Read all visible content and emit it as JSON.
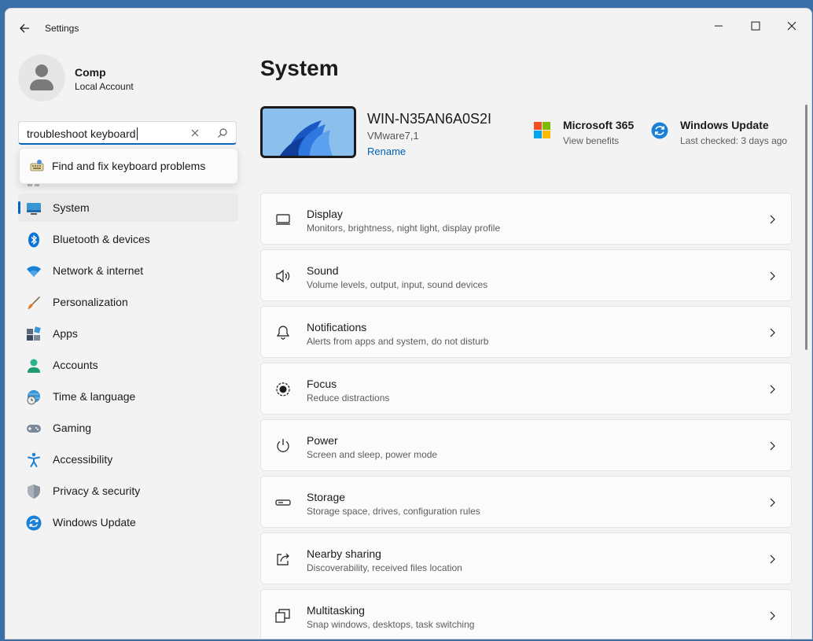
{
  "app": {
    "title": "Settings"
  },
  "user": {
    "name": "Comp",
    "account_type": "Local Account"
  },
  "search": {
    "value": "troubleshoot keyboard",
    "suggestion": "Find and fix keyboard problems"
  },
  "sidebar": {
    "items": [
      {
        "label": "System",
        "icon": "monitor-icon",
        "selected": true
      },
      {
        "label": "Bluetooth & devices",
        "icon": "bluetooth-icon"
      },
      {
        "label": "Network & internet",
        "icon": "wifi-icon"
      },
      {
        "label": "Personalization",
        "icon": "brush-icon"
      },
      {
        "label": "Apps",
        "icon": "apps-icon"
      },
      {
        "label": "Accounts",
        "icon": "person-icon"
      },
      {
        "label": "Time & language",
        "icon": "globe-clock-icon"
      },
      {
        "label": "Gaming",
        "icon": "gamepad-icon"
      },
      {
        "label": "Accessibility",
        "icon": "accessibility-icon"
      },
      {
        "label": "Privacy & security",
        "icon": "shield-icon"
      },
      {
        "label": "Windows Update",
        "icon": "update-icon"
      }
    ]
  },
  "main": {
    "title": "System",
    "device": {
      "name": "WIN-N35AN6A0S2I",
      "model": "VMware7,1",
      "rename": "Rename"
    },
    "quick": [
      {
        "title": "Microsoft 365",
        "subtitle": "View benefits",
        "icon": "microsoft-logo-icon"
      },
      {
        "title": "Windows Update",
        "subtitle": "Last checked: 3 days ago",
        "icon": "update-icon"
      }
    ],
    "cards": [
      {
        "title": "Display",
        "subtitle": "Monitors, brightness, night light, display profile",
        "icon": "display-icon"
      },
      {
        "title": "Sound",
        "subtitle": "Volume levels, output, input, sound devices",
        "icon": "speaker-icon"
      },
      {
        "title": "Notifications",
        "subtitle": "Alerts from apps and system, do not disturb",
        "icon": "bell-icon"
      },
      {
        "title": "Focus",
        "subtitle": "Reduce distractions",
        "icon": "focus-icon"
      },
      {
        "title": "Power",
        "subtitle": "Screen and sleep, power mode",
        "icon": "power-icon"
      },
      {
        "title": "Storage",
        "subtitle": "Storage space, drives, configuration rules",
        "icon": "storage-icon"
      },
      {
        "title": "Nearby sharing",
        "subtitle": "Discoverability, received files location",
        "icon": "share-icon"
      },
      {
        "title": "Multitasking",
        "subtitle": "Snap windows, desktops, task switching",
        "icon": "multitask-icon"
      }
    ]
  },
  "colors": {
    "accent": "#0067c0",
    "link": "#005fb8",
    "background": "#f3f3f3",
    "card": "#fbfbfb"
  }
}
